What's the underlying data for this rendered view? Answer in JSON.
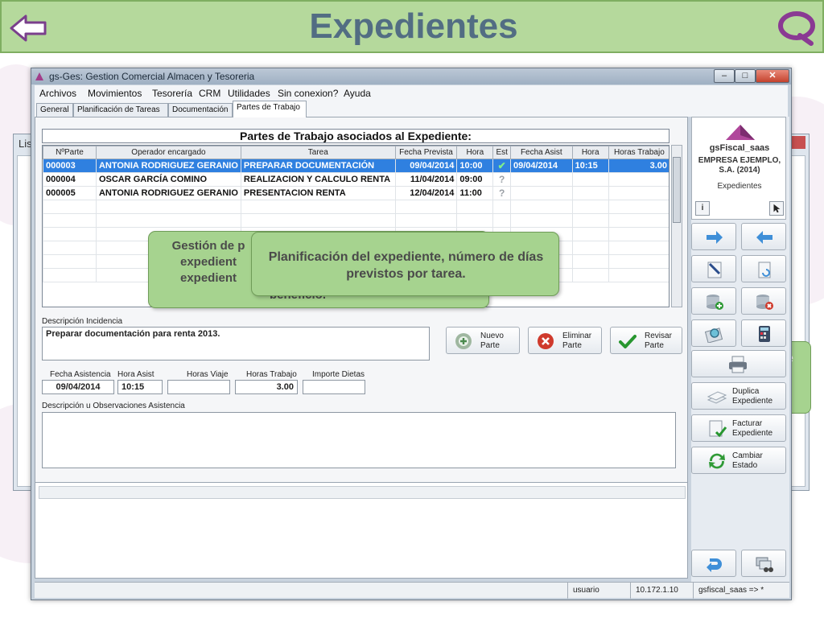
{
  "banner": {
    "title": "Expedientes"
  },
  "background": {
    "window_title": "Lis",
    "callout_fragment": "e"
  },
  "window": {
    "title": "gs-Ges: Gestion Comercial Almacen y Tesoreria",
    "minimize": "–",
    "maximize": "□",
    "close": "✕"
  },
  "menu": [
    "Archivos",
    "Movimientos",
    "Tesorería",
    "CRM",
    "Utilidades",
    "Sin conexion?",
    "Ayuda"
  ],
  "tabs": [
    "General",
    "Planificación de Tareas",
    "Documentación",
    "Partes de Trabajo"
  ],
  "grid": {
    "title": "Partes de Trabajo asociados al Expediente:",
    "headers": [
      "NºParte",
      "Operador encargado",
      "Tarea",
      "Fecha Prevista",
      "Hora",
      "Est",
      "Fecha Asist",
      "Hora",
      "Horas Trabajo"
    ],
    "rows": [
      {
        "parte": "000003",
        "operador": "ANTONIA RODRIGUEZ GERANIO",
        "tarea": "PREPARAR DOCUMENTACIÓN",
        "fecha": "09/04/2014",
        "hora": "10:00",
        "est": "check",
        "fecha_asist": "09/04/2014",
        "hora_asist": "10:15",
        "horas": "3.00"
      },
      {
        "parte": "000004",
        "operador": "OSCAR GARCÍA COMINO",
        "tarea": "REALIZACION Y CALCULO RENTA",
        "fecha": "11/04/2014",
        "hora": "09:00",
        "est": "pending",
        "fecha_asist": "",
        "hora_asist": "",
        "horas": ""
      },
      {
        "parte": "000005",
        "operador": "ANTONIA RODRIGUEZ GERANIO",
        "tarea": "PRESENTACION RENTA",
        "fecha": "12/04/2014",
        "hora": "11:00",
        "est": "pending",
        "fecha_asist": "",
        "hora_asist": "",
        "horas": ""
      }
    ],
    "empty_rows": 6
  },
  "incidencia": {
    "label": "Descripción Incidencia",
    "value": "Preparar documentación para renta 2013."
  },
  "actions": {
    "nuevo": "Nuevo\nParte",
    "eliminar": "Eliminar\nParte",
    "revisar": "Revisar\nParte"
  },
  "asistencia": {
    "fecha_label": "Fecha Asistencia",
    "fecha_value": "09/04/2014",
    "hora_label": "Hora Asist",
    "hora_value": "10:15",
    "viaje_label": "Horas Viaje",
    "viaje_value": "",
    "trabajo_label": "Horas Trabajo",
    "trabajo_value": "3.00",
    "dietas_label": "Importe Dietas",
    "dietas_value": "",
    "obs_label": "Descripción u Observaciones Asistencia"
  },
  "sidebar": {
    "app": "gsFiscal_saas",
    "company": "EMPRESA EJEMPLO, S.A. (2014)",
    "module": "Expedientes",
    "info_btn": "i",
    "duplica": "Duplica\nExpediente",
    "facturar": "Facturar\nExpediente",
    "cambiar": "Cambiar\nEstado"
  },
  "status": {
    "user": "usuario",
    "ip": "10.172.1.10",
    "db": "gsfiscal_saas => *"
  },
  "callouts": {
    "back_text": "Gestión de p\nexpedient\nexpedient",
    "back_tail": "beneficio.",
    "front_text": "Planificación del expediente, número de días previstos por tarea."
  },
  "colors": {
    "banner": "#b5d99c",
    "title": "#526d83",
    "selection": "#2f80e0",
    "callout": "#a6d38f"
  }
}
